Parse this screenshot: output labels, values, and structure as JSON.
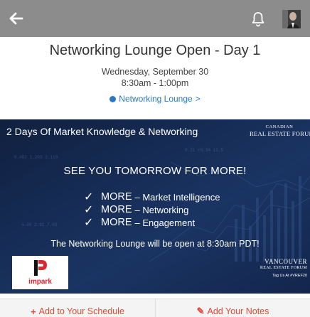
{
  "topbar": {
    "back_icon": "arrow-left-icon",
    "bell_icon": "bell-icon",
    "bg_color": "#8c8c8c"
  },
  "session": {
    "title": "Networking Lounge Open - Day 1",
    "date": "Wednesday, September 30",
    "time": "8:30am - 1:00pm",
    "location_label": "Networking Lounge",
    "location_chevron": ">",
    "link_color": "#2a78c4"
  },
  "banner": {
    "headline": "2 Days Of Market Knowledge & Networking",
    "crf_logo_small": "CANADIAN",
    "crf_logo_big": "REAL ESTATE FORUMS",
    "see_you": "SEE YOU TOMORROW FOR MORE!",
    "bullets": [
      {
        "check": "✓",
        "more": "MORE",
        "text": "– Market Intelligence"
      },
      {
        "check": "✓",
        "more": "MORE",
        "text": "– Networking"
      },
      {
        "check": "✓",
        "more": "MORE",
        "text": "– Engagement"
      }
    ],
    "open_at": "The Networking Lounge will be open at 8:30am PDT!",
    "sponsor_name": "impark",
    "vrf_city": "VANCOUVER",
    "vrf_forum": "REAL ESTATE FORUM",
    "vrf_tag": "Tag Us At #VREF20",
    "bg_color": "#14264a"
  },
  "actions": {
    "add_schedule_icon": "+",
    "add_schedule_label": "Add to Your Schedule",
    "add_notes_icon": "✎",
    "add_notes_label": "Add Your Notes",
    "accent_color": "#e54836"
  }
}
